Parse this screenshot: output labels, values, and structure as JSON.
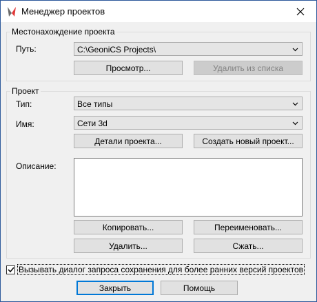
{
  "window": {
    "title": "Менеджер проектов"
  },
  "location": {
    "legend": "Местонахождение проекта",
    "path_label": "Путь:",
    "path_value": "C:\\GeoniCS Projects\\",
    "browse_button": "Просмотр...",
    "remove_button": "Удалить из списка"
  },
  "project": {
    "legend": "Проект",
    "type_label": "Тип:",
    "type_value": "Все типы",
    "name_label": "Имя:",
    "name_value": "Сети 3d",
    "details_button": "Детали проекта...",
    "create_button": "Создать новый проект...",
    "description_label": "Описание:",
    "description_value": "",
    "copy_button": "Копировать...",
    "rename_button": "Переименовать...",
    "delete_button": "Удалить...",
    "compress_button": "Сжать..."
  },
  "options": {
    "save_dialog_checked": true,
    "save_dialog_label": "Вызывать диалог запроса сохранения для более ранних версий проектов"
  },
  "footer": {
    "close_button": "Закрыть",
    "help_button": "Помощь"
  }
}
